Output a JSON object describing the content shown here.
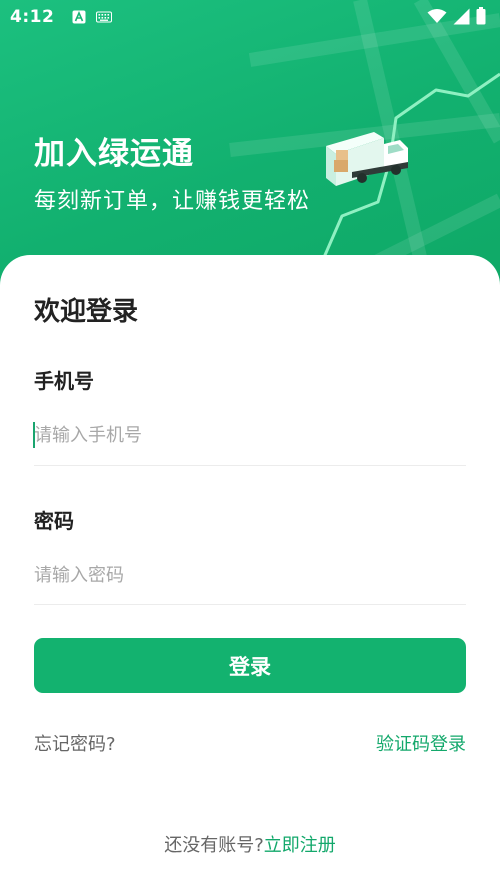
{
  "status_bar": {
    "time": "4:12",
    "icons": [
      "font-a-icon",
      "keyboard-icon",
      "wifi-icon",
      "signal-icon",
      "battery-icon"
    ]
  },
  "hero": {
    "title": "加入绿运通",
    "subtitle": "每刻新订单，让赚钱更轻松",
    "illustration": "truck-icon"
  },
  "login": {
    "welcome": "欢迎登录",
    "phone": {
      "label": "手机号",
      "placeholder": "请输入手机号",
      "value": ""
    },
    "password": {
      "label": "密码",
      "placeholder": "请输入密码",
      "value": ""
    },
    "submit_label": "登录",
    "forgot_label": "忘记密码?",
    "code_login_label": "验证码登录",
    "no_account_text": "还没有账号?",
    "register_label": "立即注册"
  },
  "colors": {
    "brand_green": "#13b26f",
    "link_green": "#13a86b",
    "text_dark": "#222222",
    "placeholder_gray": "#a8a8a8"
  }
}
